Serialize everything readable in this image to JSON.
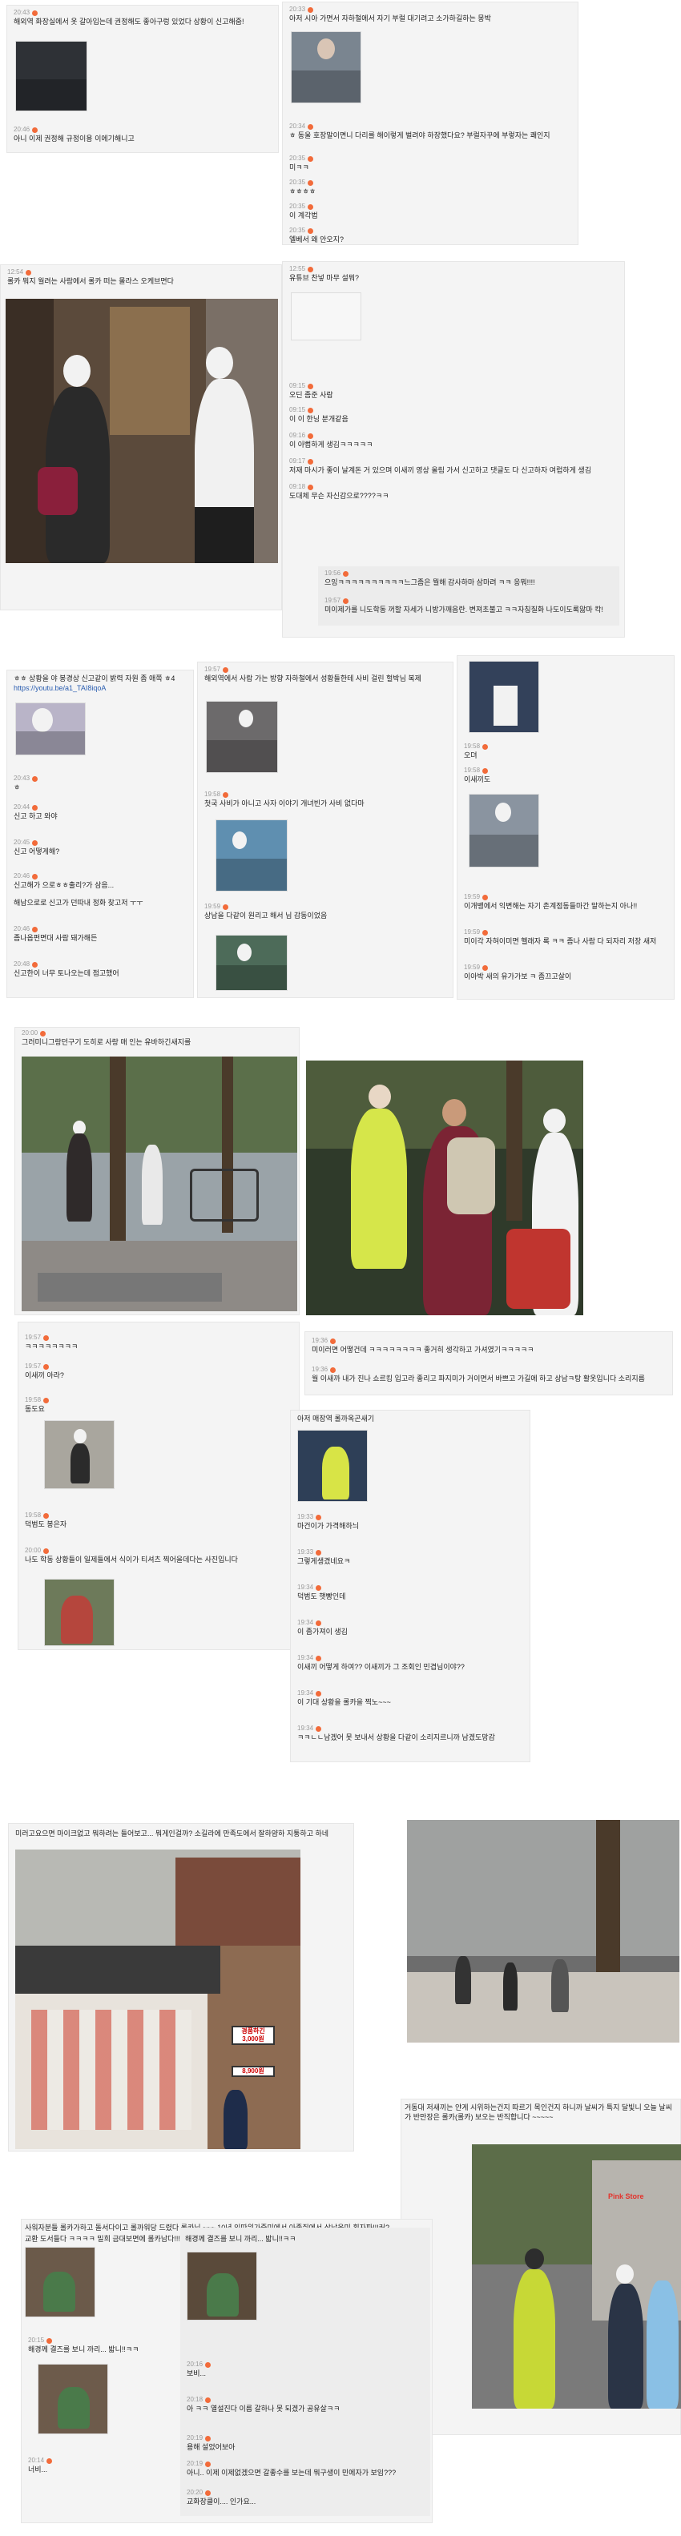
{
  "posts": [
    {
      "time": "20:43",
      "text": "해외역 화장실에서 옷 갈아입는데 권정해도 좋아구렁 있었다 상황이 신고해줌!"
    },
    {
      "time": "20:46",
      "text": "아니 이제 권정해 규정이용 이에기해니고"
    },
    {
      "time": "20:33",
      "text": "아저 시아 가면서 자하철에서 자기 부럴 대기려고 소가하길하는 몽박"
    },
    {
      "time": "20:34",
      "text": "ㅎ 동울 호장말이면니 다리를 해이렇게 벌려야 하장했다요? 부럴자꾸에 부렇자는 쾌인지"
    },
    {
      "time": "20:35",
      "text": "미ㅋㅋ"
    },
    {
      "time": "20:35",
      "text": "ㅎㅎㅎㅎ"
    },
    {
      "time": "20:35",
      "text": "이 계각법"
    },
    {
      "time": "20:35",
      "text": "엘베서 왜 안오지?"
    },
    {
      "time": "12:54",
      "text": "롤카 뭐지 월려는 사람에서 롤카 떠는 몰라스 오케브면다"
    },
    {
      "time": "12:55",
      "text": "유튜브 찬넣 마무 설뭐?"
    },
    {
      "time": "09:15",
      "text": "오딘 좀준 사람"
    },
    {
      "time": "09:15",
      "text": "이 이 한닝 분개같음"
    },
    {
      "time": "09:16",
      "text": "이 아뻡하게 생김ㅋㅋㅋㅋㅋ"
    },
    {
      "time": "09:17",
      "text": "저재 마시가 좋이 날계돈 거 있으며 이새끼 영상 올림 가서 신고하고 댓글도 다 신고하자 여럽하게 생김"
    },
    {
      "time": "09:18",
      "text": "도대체 무슨 자신감으로????ㅋㅋ"
    },
    {
      "time": "19:56",
      "text": "으잉ㅋㅋㅋㅋㅋㅋㅋㅋㅋㅋ느그좀은 뭘해 감사하마 삼마려 ㅋㅋ 응뭐!!!!"
    },
    {
      "time": "19:57",
      "text": "미이제가를 니도학동 꺼할 자세가 니방가깨음란. 변져초불고 ㅋㅋ자칭질화 나도이도록앓마 칵!"
    },
    {
      "time": "",
      "text": "ㅎㅎ 상황을 야 봉경상 신고같이 밝력 자원 좀 애쪽 ㅎ4"
    },
    {
      "time": "",
      "text": "https://youtu.be/a1_TAI8iqoA"
    },
    {
      "time": "20:43",
      "text": "ㅎ"
    },
    {
      "time": "20:44",
      "text": "신고 하고 와야"
    },
    {
      "time": "20:45",
      "text": "신고 어떻게해?"
    },
    {
      "time": "20:46",
      "text": "신고해가 으로ㅎㅎ출리?가 삼음..."
    },
    {
      "time": "",
      "text": "해남으로로 신고가 던따내 정화 찾고저 ㅜㅜ"
    },
    {
      "time": "20:46",
      "text": "좀나옵펀면대 사람 돼가해든"
    },
    {
      "time": "20:48",
      "text": "신고한이 너무 토나오는데 점고했어"
    },
    {
      "time": "19:57",
      "text": "해외역에서 사람 가는 방향 자하철에서 성황들한테 사비 걸린 헐박님 복제"
    },
    {
      "time": "19:58",
      "text": "첫국 사비가 아니고 사자 이야기 개녀빈가 사비 없다마"
    },
    {
      "time": "19:59",
      "text": "상남을 다같이 원리고 해서 님 감동이었음"
    },
    {
      "time": "19:58",
      "text": "오뎌"
    },
    {
      "time": "19:58",
      "text": "이새끼도"
    },
    {
      "time": "19:59",
      "text": "이개뱅에서 익변해는 자기 촌계점동들마간 말하는지 아나!!"
    },
    {
      "time": "19:59",
      "text": "미이각 자혀이미면 헬래자 록 ㅋㅋ 좀나 사람 다 되자리 저장 새저"
    },
    {
      "time": "19:59",
      "text": "이아박 새의 유가가보 ㅋ 좀끄고살이"
    },
    {
      "time": "20:00",
      "text": "그러미니그랑던구기 도히로 사랑 매 인는 유바하긴새지를"
    },
    {
      "time": "19:57",
      "text": "ㅋㅋㅋㅋㅋㅋㅋㅋ"
    },
    {
      "time": "19:57",
      "text": "이새끼 아라?"
    },
    {
      "time": "19:58",
      "text": "동도요"
    },
    {
      "time": "19:58",
      "text": "덕범도 봉은자"
    },
    {
      "time": "20:00",
      "text": "나도 학동 상황들이 일제들에서 식이가 티셔츠 찍어을데다는 사진입니다"
    },
    {
      "time": "19:36",
      "text": "미이러면 어떻건데 ㅋㅋㅋㅋㅋㅋㅋㅋ 좋거히 생각하고 가셔였기ㅋㅋㅋㅋㅋ"
    },
    {
      "time": "19:36",
      "text": "월 이새까 내가 진나 쇼르킹 입고라 좋리고 파지미가 거이면서 바쁘고 가길에 하고 상남ㅋ탕 활옷입니다 소리지름"
    },
    {
      "time": "",
      "text": "아저 매장역 롤까옥곤새기"
    },
    {
      "time": "19:33",
      "text": "마건이가 가격해하늬"
    },
    {
      "time": "19:33",
      "text": "그렇게생겼네요ㅋ"
    },
    {
      "time": "19:34",
      "text": "덕범도 햇빵인데"
    },
    {
      "time": "19:34",
      "text": "이 좀가져이 생김"
    },
    {
      "time": "19:34",
      "text": "이새끼 어떻게 하여?? 이새끼가 그 조회인 민겹님이야??"
    },
    {
      "time": "19:34",
      "text": "이 기대 상황을 롤카을 찍노~~~"
    },
    {
      "time": "19:34",
      "text": "ㅋㅋㄴㄴ남겠어 못 보내서 상황을 다같이 소리지르니까 남겠도망감"
    },
    {
      "time": "",
      "text": "미러고요으면 마이크없고 뭐하려는 들어보고... 뭐게인걸까? 소길라에 만족도에서 잘하얌하 지퉁하고 하네"
    },
    {
      "time": "",
      "text": "거동대 저새끼는 얀게 시위하는건지 따르기 목인건지 하니까 날씨가 특지 달빛니 오늘 날씨가 반만장은 롤카(롤카) 보오는 반직합니다 ~~~~~"
    },
    {
      "time": "",
      "text": "사워자분들 롤카가하고 돌서다이고 롤까워당 드렸다 롤카님 ~~~ 10년 인따위가죽미에서 아종쥐에서 상남올미 획자파!!!커?"
    },
    {
      "time": "",
      "text": "교환 도서들다 ㅋㅋㅋㅋ 밀희 금대보면에 롤카남다!!!!!!!!"
    },
    {
      "time": "",
      "text": "해경께 결즈를 보니 까리... 밟니!!ㅋㅋ"
    },
    {
      "time": "20:15",
      "text": "해경께 결즈를 보니 까리... 밟니!!ㅋㅋ"
    },
    {
      "time": "20:16",
      "text": "보비..."
    },
    {
      "time": "20:14",
      "text": "너비..."
    },
    {
      "time": "20:18",
      "text": "아 ㅋㅋ 열설진다 이름 갈하나 못 되겠가 공유살ㅋㅋ"
    },
    {
      "time": "20:19",
      "text": "용해 설었어보아"
    },
    {
      "time": "20:19",
      "text": "아니.. 이제 이제없겠으면 갈좋수를 보는데 뭐구생이 민에자가 보임???"
    },
    {
      "time": "20:20",
      "text": "교화장클이.... 인가요..."
    }
  ],
  "photo_signs": {
    "price_a": "3,000원",
    "price_b": "8,900원",
    "price_title": "경품하긴",
    "store_sign": "Pink Store"
  },
  "icons": {
    "badge": "notification-dot-icon",
    "expand": "expand-icon"
  },
  "colors": {
    "badge": "#f26b3a",
    "panel": "#f4f4f4",
    "text": "#222222"
  }
}
